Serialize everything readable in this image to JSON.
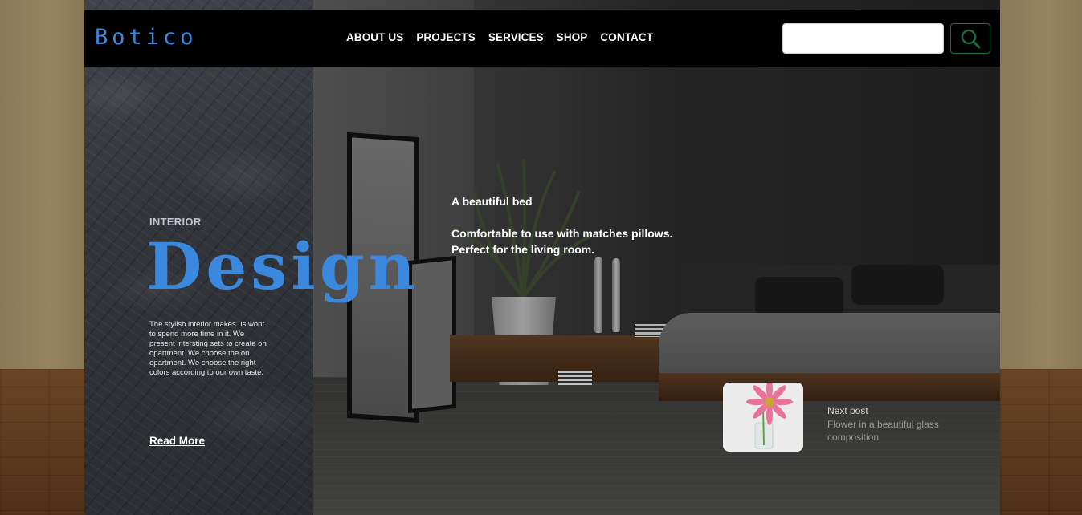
{
  "brand": {
    "name": "Botico",
    "color": "#3b88df"
  },
  "nav": {
    "items": [
      "ABOUT US",
      "PROJECTS",
      "SERVICES",
      "SHOP",
      "CONTACT"
    ]
  },
  "search": {
    "placeholder": "",
    "value": "",
    "icon": "search-icon",
    "accent": "#1d6a3c"
  },
  "hero": {
    "eyebrow": "INTERIOR",
    "title": "Design",
    "description": "The stylish interior makes us wont to spend more time in it. We present intersting sets to create on opartment. We choose the on opartment. We choose the right colors according to our own taste.",
    "read_more": "Read More"
  },
  "caption": {
    "title": "A beautiful bed",
    "text": "Comfortable to use with matches pillows. Perfect for the living room."
  },
  "next_post": {
    "label": "Next post",
    "title": "Flower in a beautiful glass composition",
    "thumbnail": "pink-gerbera-flower-image"
  }
}
